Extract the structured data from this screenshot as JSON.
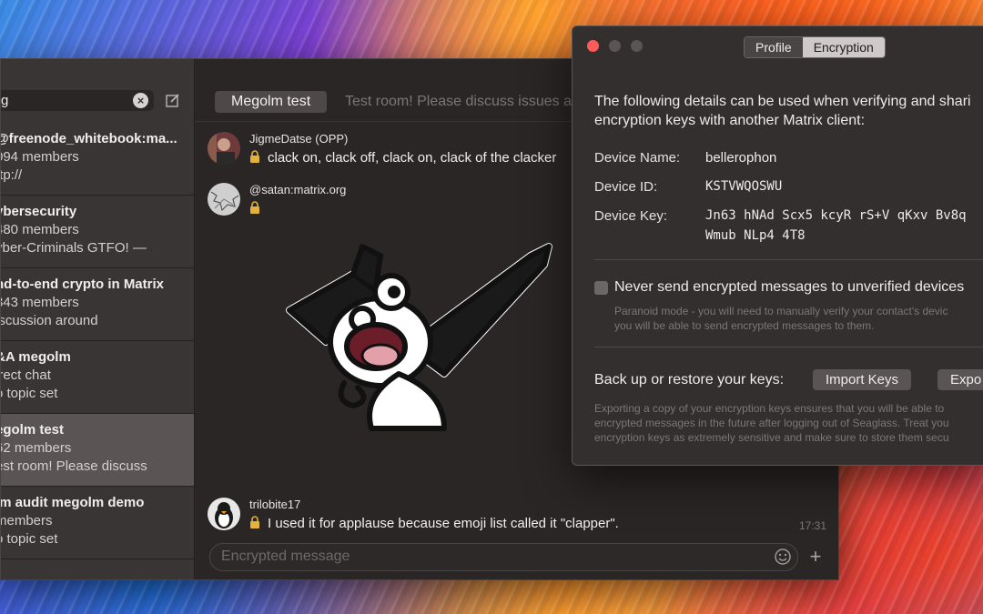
{
  "sidebar": {
    "search_value": "g",
    "rooms": [
      {
        "name": "@freenode_whitebook:ma...",
        "members": "094 members",
        "topic": "ttp://"
      },
      {
        "name": "ybersecurity",
        "members": "480 members",
        "topic": "yber-Criminals GTFO!  —"
      },
      {
        "name": "nd-to-end crypto in Matrix",
        "members": "343 members",
        "topic": "iscussion around"
      },
      {
        "name": "&A megolm",
        "members": "irect chat",
        "topic": "o topic set"
      },
      {
        "name": "egolm test",
        "members": "62 members",
        "topic": "est room! Please discuss"
      },
      {
        "name": "lm audit megolm demo",
        "members": " members",
        "topic": "o topic set"
      }
    ]
  },
  "chat": {
    "room_name": "Megolm test",
    "topic": "Test room! Please discuss issues a",
    "messages": [
      {
        "sender": "JigmeDatse (OPP)",
        "body": "clack on, clack off, clack on, clack of the clacker"
      },
      {
        "sender": "@satan:matrix.org",
        "body": ""
      },
      {
        "sender": "trilobite17",
        "body": "I used it for applause because emoji list called it \"clapper\".",
        "time": "17:31"
      }
    ],
    "composer_placeholder": "Encrypted message",
    "attach_symbol": "+"
  },
  "panel": {
    "tabs": [
      "Profile",
      "Encryption"
    ],
    "active_tab": "Encryption",
    "description_line1": "The following details can be used when verifying and shari",
    "description_line2": "encryption keys with another Matrix client:",
    "device_name_label": "Device Name:",
    "device_name": "bellerophon",
    "device_id_label": "Device ID:",
    "device_id": "KSTVWQOSWU",
    "device_key_label": "Device Key:",
    "device_key_line1": "Jn63 hNAd Scx5 kcyR rS+V qKxv Bv8q",
    "device_key_line2": "Wmub NLp4 4T8",
    "never_send_label": "Never send encrypted messages to unverified devices",
    "never_send_checked": false,
    "paranoid_line1": "Paranoid mode - you will need to manually verify your contact's devic",
    "paranoid_line2": "you will be able to send encrypted messages to them.",
    "backup_label": "Back up or restore your keys:",
    "import_button": "Import Keys",
    "export_button": "Expo",
    "export_help_line1": "Exporting a copy of your encryption keys ensures that you will be able to",
    "export_help_line2": "encrypted messages in the future after logging out of Seaglass. Treat you",
    "export_help_line3": "encryption keys as extremely sensitive and make sure to store them secu"
  },
  "colors": {
    "close": "#fc5b57",
    "selected_row": "#5a5454"
  }
}
